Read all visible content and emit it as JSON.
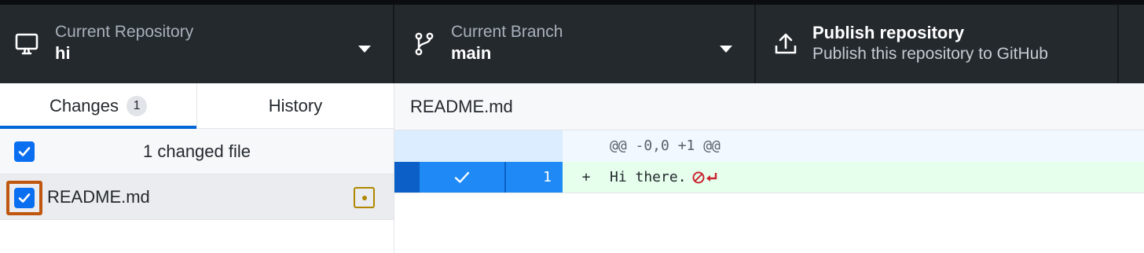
{
  "toolbar": {
    "repository": {
      "description": "Current Repository",
      "title": "hi",
      "icon": "desktop-icon"
    },
    "branch": {
      "description": "Current Branch",
      "title": "main",
      "icon": "git-branch-icon"
    },
    "publish": {
      "title": "Publish repository",
      "description": "Publish this repository to GitHub",
      "icon": "upload-icon"
    }
  },
  "tabs": {
    "changes_label": "Changes",
    "changes_count": "1",
    "history_label": "History"
  },
  "changes": {
    "summary": "1 changed file",
    "files": [
      {
        "name": "README.md",
        "status": "modified",
        "checked": true
      }
    ]
  },
  "diff": {
    "file_name": "README.md",
    "hunk_header": "@@ -0,0 +1 @@",
    "lines": [
      {
        "type": "add",
        "line_number": "1",
        "marker": "+",
        "text": "Hi there."
      }
    ]
  },
  "colors": {
    "toolbar_bg": "#24292e",
    "accent": "#0366d6",
    "highlight_outline": "#c0570f",
    "added_bg": "#e6ffed",
    "modified_status": "#b08800"
  }
}
